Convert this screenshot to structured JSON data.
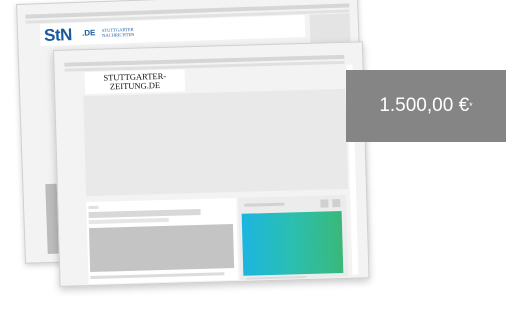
{
  "back_site": {
    "logo_main": "StN",
    "logo_suffix": ".DE",
    "logo_sub": "STUTTGARTER NACHRICHTEN"
  },
  "front_site": {
    "logo_text": "STUTTGARTER-\nZEITUNG.DE"
  },
  "price": {
    "amount": "1.500,00 €",
    "footnote_mark": "*"
  },
  "colors": {
    "back_logo": "#1a5a9e",
    "badge_bg": "#858585",
    "gradient_start": "#1cb5e0",
    "gradient_end": "#3ab87a"
  }
}
